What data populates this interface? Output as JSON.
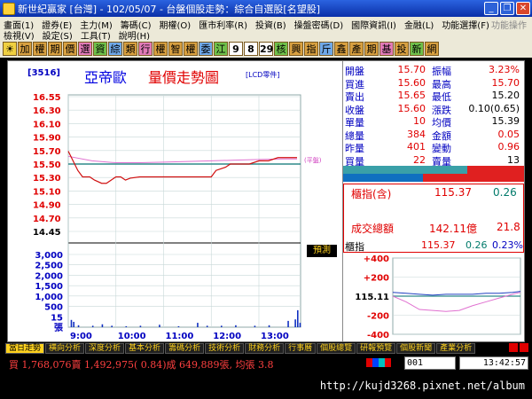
{
  "window": {
    "title": "新世紀贏家 [台灣] - 102/05/07 - 台盤個股走勢：綜合自選股[名望股]",
    "minimize": "_",
    "restore": "❐",
    "close": "✕"
  },
  "menu": {
    "row1": [
      "畫面(1)",
      "證券(E)",
      "主力(M)",
      "籌碼(C)",
      "期權(O)",
      "匯市利率(R)",
      "投資(B)",
      "操盤密碼(D)",
      "國際資訊(I)",
      "金融(L)",
      "功能選擇(F)"
    ],
    "row2": [
      "檢視(V)",
      "設定(S)",
      "工具(T)",
      "說明(H)"
    ],
    "right_hint": "功能操作"
  },
  "toolbar": {
    "buttons": [
      "☀",
      "加",
      "權",
      "期",
      "價",
      "選",
      "資",
      "綜",
      "類",
      "行",
      "權",
      "智",
      "權",
      "委",
      "江",
      "9",
      "8",
      "29",
      "核",
      "興",
      "指",
      "斤",
      "鑫",
      "產",
      "期",
      "基",
      "投",
      "新",
      "網"
    ]
  },
  "stock": {
    "code": "[3516]",
    "name": "亞帝歐",
    "chart_title": "量價走勢圖",
    "chart_sub": "[LCD零件]",
    "ref_label": "(平盤)",
    "predict_tab": "預測"
  },
  "info": {
    "rows": [
      {
        "l1": "開盤",
        "v1": "15.70",
        "c1": "red",
        "l2": "振幅",
        "v2": "3.23%",
        "c2": "red"
      },
      {
        "l1": "買進",
        "v1": "15.60",
        "c1": "red",
        "l2": "最高",
        "v2": "15.70",
        "c2": "red"
      },
      {
        "l1": "賣出",
        "v1": "15.65",
        "c1": "red",
        "l2": "最低",
        "v2": "15.20",
        "c2": "black"
      },
      {
        "l1": "收盤",
        "v1": "15.60",
        "c1": "red",
        "l2": "漲跌",
        "v2": "0.10(0.65)",
        "c2": "black"
      },
      {
        "l1": "單量",
        "v1": "10",
        "c1": "red",
        "l2": "均價",
        "v2": "15.39",
        "c2": "black"
      },
      {
        "l1": "總量",
        "v1": "384",
        "c1": "red",
        "l2": "金額",
        "v2": "0.05",
        "c2": "red"
      },
      {
        "l1": "昨量",
        "v1": "401",
        "c1": "red",
        "l2": "變動",
        "v2": "0.96",
        "c2": "red"
      },
      {
        "l1": "買量",
        "v1": "22",
        "c1": "red",
        "l2": "賣量",
        "v2": "13",
        "c2": "black"
      }
    ],
    "index_label": "櫃指(含)",
    "index_value": "115.37",
    "index_change": "0.26",
    "amount_label": "成交總額",
    "amount_value": "142.11億",
    "amount_change": "21.8"
  },
  "mini": {
    "label": "櫃指",
    "value": "115.37",
    "change": "0.26",
    "pct": "0.23%",
    "ticks": [
      "+400",
      "+200",
      "115.11",
      "-200",
      "-400"
    ]
  },
  "tabs": [
    "當日走勢",
    "横向分析",
    "深度分析",
    "基本分析",
    "籌碼分析",
    "技術分析",
    "財務分析",
    "行事曆",
    "個股總覽",
    "研報預覽",
    "個股新聞",
    "產業分析"
  ],
  "status": {
    "text": "買 1,768,076賣 1,492,975( 0.84)成 649,889張, 均張 3.8",
    "input": "001",
    "time": "13:42:57"
  },
  "footer": {
    "url": "http://kujd3268.pixnet.net/album"
  },
  "chart_data": {
    "type": "line",
    "price_axis": [
      "16.55",
      "16.30",
      "16.10",
      "15.90",
      "15.70",
      "15.50",
      "15.30",
      "15.10",
      "14.90",
      "14.70",
      "14.45"
    ],
    "volume_axis": [
      "3,000",
      "2,500",
      "2,000",
      "1,500",
      "1,000",
      "500",
      "15",
      "張"
    ],
    "time_axis": [
      "9:00",
      "10:00",
      "11:00",
      "12:00",
      "13:00"
    ],
    "ylim": [
      14.45,
      16.55
    ],
    "reference_price": 15.5,
    "price_series": {
      "x": [
        0.0,
        0.1,
        0.2,
        0.3,
        0.45,
        0.55,
        0.7,
        0.8,
        0.9,
        1.0,
        1.1,
        1.2,
        1.3,
        1.5,
        1.7,
        2.0,
        2.3,
        2.6,
        2.7,
        2.8,
        3.0,
        3.1,
        3.3,
        3.4,
        3.6,
        3.8,
        4.0,
        4.2,
        4.4,
        4.6,
        4.8
      ],
      "values": [
        15.7,
        15.55,
        15.4,
        15.3,
        15.3,
        15.25,
        15.2,
        15.2,
        15.25,
        15.3,
        15.3,
        15.25,
        15.28,
        15.3,
        15.3,
        15.3,
        15.3,
        15.3,
        15.3,
        15.3,
        15.3,
        15.4,
        15.45,
        15.5,
        15.5,
        15.5,
        15.55,
        15.55,
        15.6,
        15.6,
        15.6
      ]
    },
    "avg_series": {
      "x": [
        0.0,
        0.5,
        1.0,
        1.5,
        2.0,
        2.5,
        3.0,
        3.5,
        4.0,
        4.5,
        4.8
      ],
      "values": [
        15.62,
        15.55,
        15.52,
        15.52,
        15.53,
        15.54,
        15.55,
        15.56,
        15.57,
        15.58,
        15.58
      ]
    },
    "volume": {
      "x": [
        0.05,
        0.1,
        0.2,
        0.5,
        0.7,
        0.9,
        1.2,
        1.5,
        1.9,
        2.3,
        2.7,
        2.9,
        3.2,
        3.5,
        3.9,
        4.2,
        4.6,
        4.75,
        4.8,
        4.85
      ],
      "values": [
        300,
        220,
        80,
        60,
        120,
        60,
        40,
        60,
        100,
        40,
        180,
        60,
        60,
        80,
        60,
        80,
        260,
        320,
        700,
        180
      ]
    },
    "mini_series": {
      "x": [
        0.0,
        0.5,
        1.0,
        1.5,
        2.0,
        2.5,
        3.0,
        3.5,
        4.0,
        4.5,
        4.8
      ],
      "values": [
        0,
        -60,
        -140,
        -150,
        -160,
        -150,
        -100,
        -60,
        -20,
        20,
        40
      ]
    },
    "mini_series2": {
      "x": [
        0.0,
        0.5,
        1.0,
        1.5,
        2.0,
        2.5,
        3.0,
        3.5,
        4.0,
        4.5,
        4.8
      ],
      "values": [
        40,
        30,
        20,
        10,
        20,
        20,
        20,
        30,
        30,
        40,
        50
      ]
    }
  }
}
